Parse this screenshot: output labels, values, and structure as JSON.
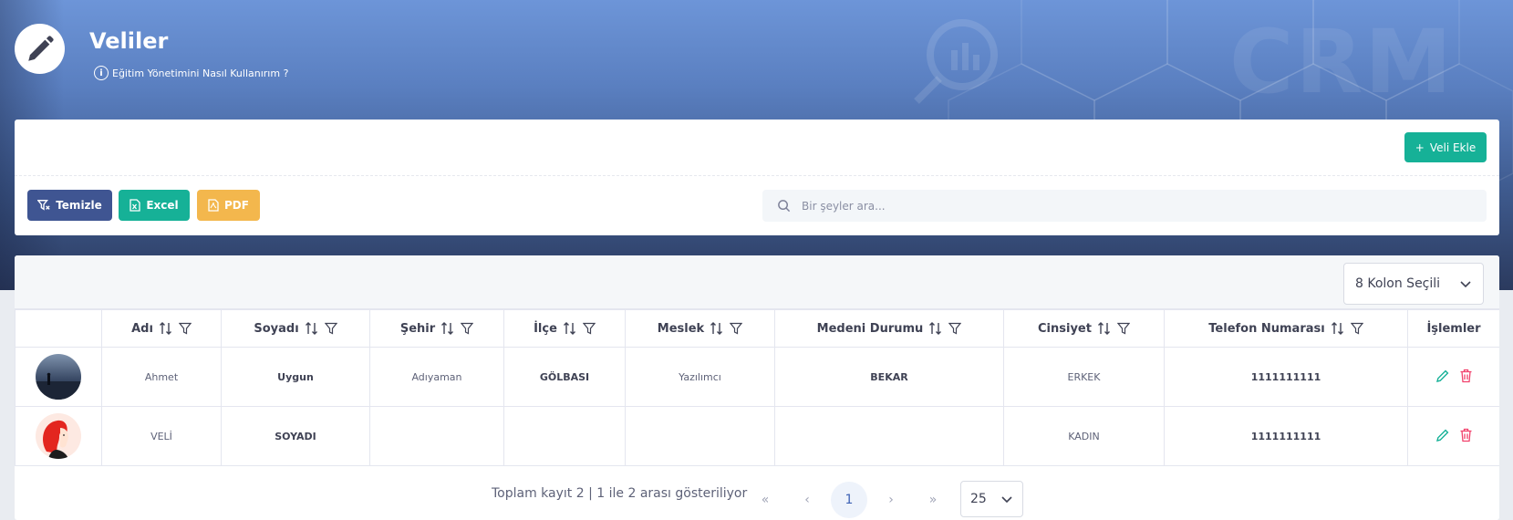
{
  "header": {
    "title": "Veliler",
    "help_text": "Eğitim Yönetimini Nasıl Kullanırım ?",
    "background_watermark": "CRM"
  },
  "toolbar": {
    "add_label": "Veli Ekle",
    "clear_label": "Temizle",
    "excel_label": "Excel",
    "pdf_label": "PDF",
    "search_placeholder": "Bir şeyler ara..."
  },
  "table": {
    "column_selector": "8 Kolon Seçili",
    "columns": [
      "Adı",
      "Soyadı",
      "Şehir",
      "İlçe",
      "Meslek",
      "Medeni Durumu",
      "Cinsiyet",
      "Telefon Numarası",
      "İşlemler"
    ],
    "rows": [
      {
        "ad": "Ahmet",
        "soyad": "Uygun",
        "sehir": "Adıyaman",
        "ilce": "GÖLBASI",
        "meslek": "Yazılımcı",
        "medeni": "BEKAR",
        "cinsiyet": "ERKEK",
        "telefon": "1111111111"
      },
      {
        "ad": "VELİ",
        "soyad": "SOYADI",
        "sehir": "",
        "ilce": "",
        "meslek": "",
        "medeni": "",
        "cinsiyet": "KADIN",
        "telefon": "1111111111"
      }
    ]
  },
  "pagination": {
    "summary": "Toplam kayıt 2 | 1 ile 2 arası gösteriliyor",
    "first": "«",
    "prev": "‹",
    "current_page": "1",
    "next": "›",
    "last": "»",
    "page_size": "25"
  },
  "colors": {
    "primary": "#3f5592",
    "success": "#16b197",
    "warning": "#f3b74d",
    "danger": "#f1416c"
  }
}
